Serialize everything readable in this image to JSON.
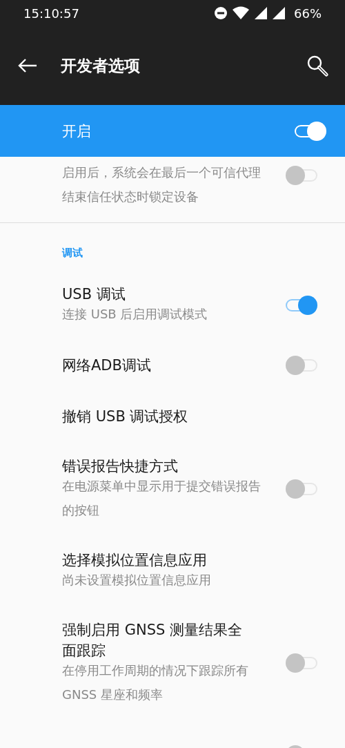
{
  "status_bar": {
    "time": "15:10:57",
    "battery": "66%"
  },
  "toolbar": {
    "title": "开发者选项"
  },
  "master_switch": {
    "label": "开启",
    "on": true
  },
  "items": [
    {
      "kind": "setting",
      "summary": "启用后，系统会在最后一个可信代理结束信任状态时锁定设备",
      "switch": {
        "on": false
      },
      "divider": true
    },
    {
      "kind": "category",
      "title": "调试"
    },
    {
      "kind": "setting",
      "title": "USB 调试",
      "summary": "连接 USB 后启用调试模式",
      "switch": {
        "on": true
      }
    },
    {
      "kind": "setting",
      "title": "网络ADB调试",
      "switch": {
        "on": false
      }
    },
    {
      "kind": "setting",
      "title": "撤销 USB 调试授权"
    },
    {
      "kind": "setting",
      "title": "错误报告快捷方式",
      "summary": "在电源菜单中显示用于提交错误报告的按钮",
      "switch": {
        "on": false
      }
    },
    {
      "kind": "setting",
      "title": "选择模拟位置信息应用",
      "summary": "尚未设置模拟位置信息应用"
    },
    {
      "kind": "setting",
      "title": "强制启用 GNSS 测量结果全面跟踪",
      "summary": "在停用工作周期的情况下跟踪所有 GNSS 星座和频率",
      "switch": {
        "on": false
      }
    },
    {
      "kind": "setting",
      "switch": {
        "on": false
      }
    }
  ]
}
